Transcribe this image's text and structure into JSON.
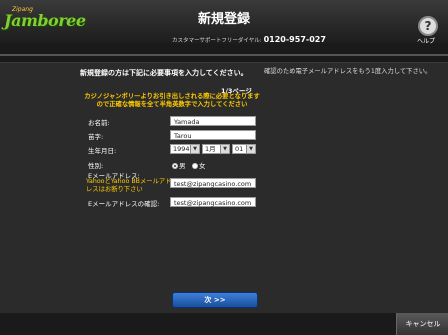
{
  "header": {
    "logo_small": "Zipang",
    "logo_big": "Jamboree",
    "title": "新規登録",
    "support_label": "カスタマーサポートフリーダイヤル:",
    "support_number": "0120-957-027",
    "help_label": "ヘルプ"
  },
  "form": {
    "intro": "新規登録の方は下記に必要事項を入力してください。",
    "page_indicator": "1/3ページ",
    "warning": "カジノジャンボリーよりお引き出しされる際に必要となりますので正確な情報を全て半角英数字で入力してください",
    "side_note": "確認のため電子メールアドレスをもう1度入力して下さい。",
    "first_name_label": "お名前:",
    "first_name_value": "Yamada",
    "last_name_label": "苗字:",
    "last_name_value": "Tarou",
    "dob_label": "生年月日:",
    "dob_year": "1994",
    "dob_month": "1月",
    "dob_day": "01",
    "gender_label": "性別:",
    "gender_male": "男",
    "gender_female": "女",
    "email_label": "Eメールアドレス:",
    "email_note": "YahooとYahoo BBメールアドレスはお断り下さい",
    "email_value": "test@zipangcasino.com",
    "email_confirm_label": "Eメールアドレスの確認:",
    "email_confirm_value": "test@zipangcasino.com",
    "next_label": "次 >>",
    "cancel_label": "キャンセル"
  },
  "icons": {
    "help": "question-icon",
    "select_arrow": "chevron-down-icon"
  },
  "colors": {
    "warning": "#ffcc00",
    "logo": "#7fd030",
    "next_button": "#2a64b8"
  }
}
